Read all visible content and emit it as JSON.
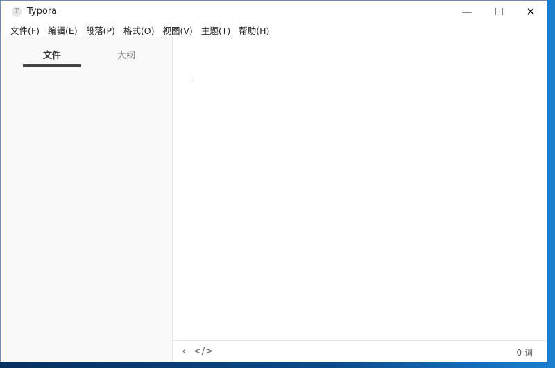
{
  "window": {
    "title": "Typora",
    "app_icon_letter": "T",
    "controls": {
      "minimize": "—",
      "maximize": "☐",
      "close": "✕"
    }
  },
  "menu": [
    {
      "label": "文件(F)"
    },
    {
      "label": "编辑(E)"
    },
    {
      "label": "段落(P)"
    },
    {
      "label": "格式(O)"
    },
    {
      "label": "视图(V)"
    },
    {
      "label": "主题(T)"
    },
    {
      "label": "帮助(H)"
    }
  ],
  "sidebar": {
    "tabs": [
      {
        "label": "文件",
        "active": true
      },
      {
        "label": "大纲",
        "active": false
      }
    ]
  },
  "footer": {
    "back_icon": "‹",
    "source_icon": "</>",
    "word_count": "0 词"
  },
  "colors": {
    "sidebar_bg": "#f9f9f9",
    "active_tab_indicator": "#444444"
  }
}
